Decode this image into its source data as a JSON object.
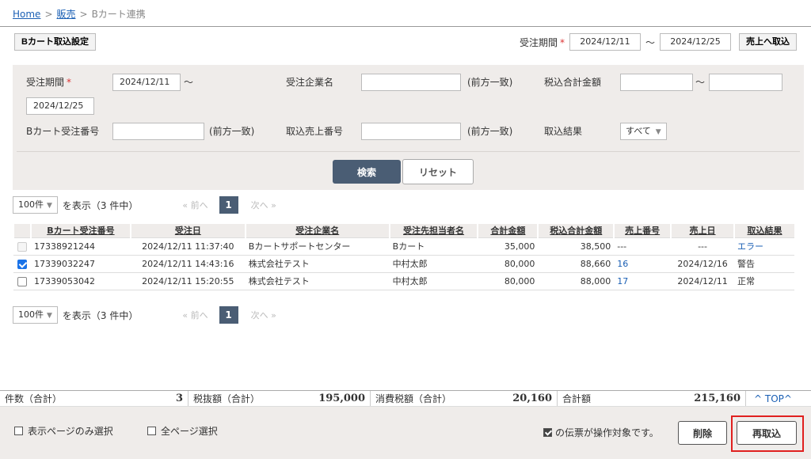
{
  "breadcrumb": {
    "home": "Home",
    "sales": "販売",
    "current": "Bカート連携",
    "sep": ">"
  },
  "toolbar": {
    "setting_button": "Bカート取込設定",
    "period_label": "受注期間",
    "required_mark": "*",
    "period_from": "2024/12/11",
    "tilde": "～",
    "period_to": "2024/12/25",
    "sales_import_button": "売上へ取込"
  },
  "search": {
    "order_period_label": "受注期間",
    "required_mark": "*",
    "order_period_from": "2024/12/11",
    "tilde": "～",
    "order_period_to": "2024/12/25",
    "company_label": "受注企業名",
    "company_value": "",
    "partial_match": "(前方一致)",
    "total_label": "税込合計金額",
    "total_from": "",
    "total_to": "",
    "bcart_no_label": "Bカート受注番号",
    "bcart_no_value": "",
    "sales_no_label": "取込売上番号",
    "sales_no_value": "",
    "result_label": "取込結果",
    "result_selected": "すべて",
    "search_button": "検索",
    "reset_button": "リセット"
  },
  "pager": {
    "per_page": "100件",
    "display_text": "を表示（3 件中）",
    "prev": "«  前へ",
    "current_page": "1",
    "next": "次へ  »"
  },
  "table": {
    "headers": [
      "",
      "Bカート受注番号",
      "受注日",
      "受注企業名",
      "受注先担当者名",
      "合計金額",
      "税込合計金額",
      "売上番号",
      "売上日",
      "取込結果"
    ],
    "rows": [
      {
        "checkbox": "disabled",
        "order_no": "17338921244",
        "order_date": "2024/12/11 11:37:40",
        "company": "Bカートサポートセンター",
        "contact": "Bカート",
        "total": "35,000",
        "total_tax": "38,500",
        "sales_no": "---",
        "sales_date": "---",
        "result": "エラー"
      },
      {
        "checkbox": "checked",
        "order_no": "17339032247",
        "order_date": "2024/12/11 14:43:16",
        "company": "株式会社テスト",
        "contact": "中村太郎",
        "total": "80,000",
        "total_tax": "88,660",
        "sales_no": "16",
        "sales_date": "2024/12/16",
        "result": "警告"
      },
      {
        "checkbox": "unchecked",
        "order_no": "17339053042",
        "order_date": "2024/12/11 15:20:55",
        "company": "株式会社テスト",
        "contact": "中村太郎",
        "total": "80,000",
        "total_tax": "88,000",
        "sales_no": "17",
        "sales_date": "2024/12/11",
        "result": "正常"
      }
    ]
  },
  "totals": {
    "count_label": "件数（合計）",
    "count_value": "3",
    "pretax_label": "税抜額（合計）",
    "pretax_value": "195,000",
    "tax_label": "消費税額（合計）",
    "tax_value": "20,160",
    "grand_label": "合計額",
    "grand_value": "215,160",
    "top_link": "TOP"
  },
  "footer": {
    "select_page": "表示ページのみ選択",
    "select_all": "全ページ選択",
    "note": "の伝票が操作対象です。",
    "delete_button": "削除",
    "reimport_button": "再取込"
  },
  "colors": {
    "accent": "#4a5d74",
    "link": "#1a5fb4",
    "highlight": "#e0201f",
    "panel": "#efecea"
  }
}
